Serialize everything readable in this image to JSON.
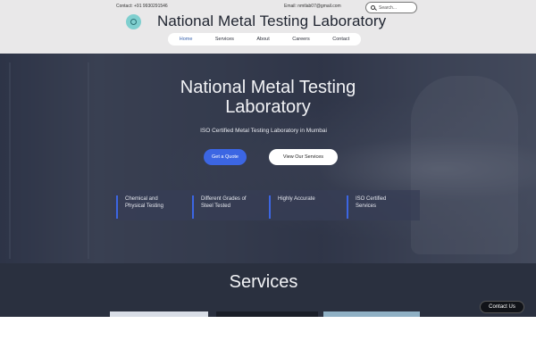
{
  "header": {
    "phone": "Contact: +91 9930291546",
    "email": "Email: nmtlab07@gmail.com",
    "search_placeholder": "Search...",
    "title": "National Metal Testing Laboratory"
  },
  "nav": {
    "items": [
      "Home",
      "Services",
      "About",
      "Careers",
      "Contact"
    ],
    "active": "Home"
  },
  "hero": {
    "title_line1": "National Metal Testing",
    "title_line2": "Laboratory",
    "subtitle": "ISO Certified Metal Testing Laboratory in Mumbai",
    "quote_button": "Get a Quote",
    "services_button": "View Our Services",
    "features": [
      {
        "line1": "Chemical and",
        "line2": "Physical Testing"
      },
      {
        "line1": "Different Grades of",
        "line2": "Steel Tested"
      },
      {
        "line1": "Highly Accurate",
        "line2": ""
      },
      {
        "line1": "ISO Certified",
        "line2": "Services"
      }
    ]
  },
  "services": {
    "title": "Services"
  },
  "chat": {
    "label": "Contact Us"
  },
  "colors": {
    "accent": "#3c66e3",
    "header_bg": "#e9e8e9",
    "hero_overlay": "#23283a",
    "services_bg": "#2a303f"
  },
  "icons": [
    "search-icon",
    "logo-icon"
  ]
}
